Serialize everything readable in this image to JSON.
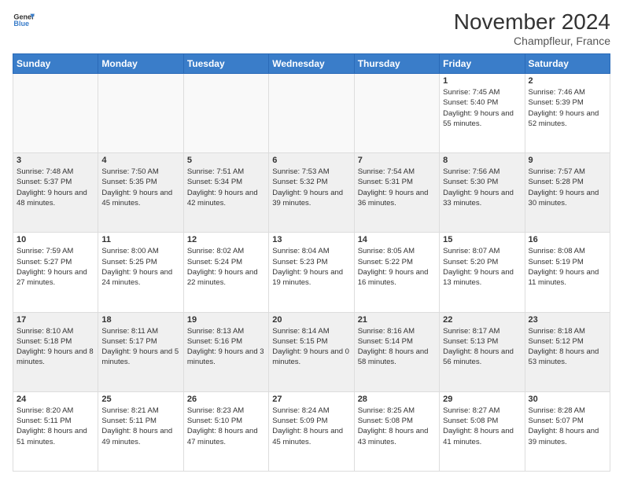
{
  "logo": {
    "line1": "General",
    "line2": "Blue"
  },
  "title": "November 2024",
  "subtitle": "Champfleur, France",
  "days_header": [
    "Sunday",
    "Monday",
    "Tuesday",
    "Wednesday",
    "Thursday",
    "Friday",
    "Saturday"
  ],
  "weeks": [
    [
      {
        "day": "",
        "info": ""
      },
      {
        "day": "",
        "info": ""
      },
      {
        "day": "",
        "info": ""
      },
      {
        "day": "",
        "info": ""
      },
      {
        "day": "",
        "info": ""
      },
      {
        "day": "1",
        "info": "Sunrise: 7:45 AM\nSunset: 5:40 PM\nDaylight: 9 hours and 55 minutes."
      },
      {
        "day": "2",
        "info": "Sunrise: 7:46 AM\nSunset: 5:39 PM\nDaylight: 9 hours and 52 minutes."
      }
    ],
    [
      {
        "day": "3",
        "info": "Sunrise: 7:48 AM\nSunset: 5:37 PM\nDaylight: 9 hours and 48 minutes."
      },
      {
        "day": "4",
        "info": "Sunrise: 7:50 AM\nSunset: 5:35 PM\nDaylight: 9 hours and 45 minutes."
      },
      {
        "day": "5",
        "info": "Sunrise: 7:51 AM\nSunset: 5:34 PM\nDaylight: 9 hours and 42 minutes."
      },
      {
        "day": "6",
        "info": "Sunrise: 7:53 AM\nSunset: 5:32 PM\nDaylight: 9 hours and 39 minutes."
      },
      {
        "day": "7",
        "info": "Sunrise: 7:54 AM\nSunset: 5:31 PM\nDaylight: 9 hours and 36 minutes."
      },
      {
        "day": "8",
        "info": "Sunrise: 7:56 AM\nSunset: 5:30 PM\nDaylight: 9 hours and 33 minutes."
      },
      {
        "day": "9",
        "info": "Sunrise: 7:57 AM\nSunset: 5:28 PM\nDaylight: 9 hours and 30 minutes."
      }
    ],
    [
      {
        "day": "10",
        "info": "Sunrise: 7:59 AM\nSunset: 5:27 PM\nDaylight: 9 hours and 27 minutes."
      },
      {
        "day": "11",
        "info": "Sunrise: 8:00 AM\nSunset: 5:25 PM\nDaylight: 9 hours and 24 minutes."
      },
      {
        "day": "12",
        "info": "Sunrise: 8:02 AM\nSunset: 5:24 PM\nDaylight: 9 hours and 22 minutes."
      },
      {
        "day": "13",
        "info": "Sunrise: 8:04 AM\nSunset: 5:23 PM\nDaylight: 9 hours and 19 minutes."
      },
      {
        "day": "14",
        "info": "Sunrise: 8:05 AM\nSunset: 5:22 PM\nDaylight: 9 hours and 16 minutes."
      },
      {
        "day": "15",
        "info": "Sunrise: 8:07 AM\nSunset: 5:20 PM\nDaylight: 9 hours and 13 minutes."
      },
      {
        "day": "16",
        "info": "Sunrise: 8:08 AM\nSunset: 5:19 PM\nDaylight: 9 hours and 11 minutes."
      }
    ],
    [
      {
        "day": "17",
        "info": "Sunrise: 8:10 AM\nSunset: 5:18 PM\nDaylight: 9 hours and 8 minutes."
      },
      {
        "day": "18",
        "info": "Sunrise: 8:11 AM\nSunset: 5:17 PM\nDaylight: 9 hours and 5 minutes."
      },
      {
        "day": "19",
        "info": "Sunrise: 8:13 AM\nSunset: 5:16 PM\nDaylight: 9 hours and 3 minutes."
      },
      {
        "day": "20",
        "info": "Sunrise: 8:14 AM\nSunset: 5:15 PM\nDaylight: 9 hours and 0 minutes."
      },
      {
        "day": "21",
        "info": "Sunrise: 8:16 AM\nSunset: 5:14 PM\nDaylight: 8 hours and 58 minutes."
      },
      {
        "day": "22",
        "info": "Sunrise: 8:17 AM\nSunset: 5:13 PM\nDaylight: 8 hours and 56 minutes."
      },
      {
        "day": "23",
        "info": "Sunrise: 8:18 AM\nSunset: 5:12 PM\nDaylight: 8 hours and 53 minutes."
      }
    ],
    [
      {
        "day": "24",
        "info": "Sunrise: 8:20 AM\nSunset: 5:11 PM\nDaylight: 8 hours and 51 minutes."
      },
      {
        "day": "25",
        "info": "Sunrise: 8:21 AM\nSunset: 5:11 PM\nDaylight: 8 hours and 49 minutes."
      },
      {
        "day": "26",
        "info": "Sunrise: 8:23 AM\nSunset: 5:10 PM\nDaylight: 8 hours and 47 minutes."
      },
      {
        "day": "27",
        "info": "Sunrise: 8:24 AM\nSunset: 5:09 PM\nDaylight: 8 hours and 45 minutes."
      },
      {
        "day": "28",
        "info": "Sunrise: 8:25 AM\nSunset: 5:08 PM\nDaylight: 8 hours and 43 minutes."
      },
      {
        "day": "29",
        "info": "Sunrise: 8:27 AM\nSunset: 5:08 PM\nDaylight: 8 hours and 41 minutes."
      },
      {
        "day": "30",
        "info": "Sunrise: 8:28 AM\nSunset: 5:07 PM\nDaylight: 8 hours and 39 minutes."
      }
    ]
  ]
}
